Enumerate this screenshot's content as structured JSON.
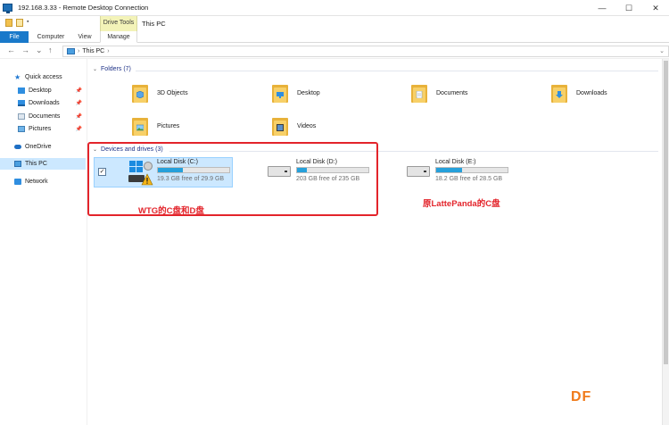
{
  "rdp": {
    "title": "192.168.3.33 - Remote Desktop Connection",
    "minimize": "—",
    "maximize": "☐",
    "close": "✕"
  },
  "explorer": {
    "title": "This PC",
    "drive_tools": "Drive Tools",
    "ribbon_tabs": [
      "File",
      "Computer",
      "View",
      "Manage"
    ]
  },
  "address": {
    "back": "←",
    "forward": "→",
    "recent": "⌄",
    "up": "↑",
    "sep": "›",
    "path": "This PC",
    "dropdown": "⌄"
  },
  "sidebar": {
    "quick_access": "Quick access",
    "items": [
      "Desktop",
      "Downloads",
      "Documents",
      "Pictures"
    ],
    "pin": "📌",
    "onedrive": "OneDrive",
    "this_pc": "This PC",
    "network": "Network"
  },
  "folders": {
    "header": "Folders (7)",
    "items": [
      "3D Objects",
      "Desktop",
      "Documents",
      "Downloads",
      "Pictures",
      "Videos"
    ]
  },
  "drives": {
    "header": "Devices and drives (3)",
    "items": [
      {
        "name": "Local Disk (C:)",
        "free": "19.3 GB free of 29.9 GB",
        "used_fraction": 0.35
      },
      {
        "name": "Local Disk (D:)",
        "free": "203 GB free of 235 GB",
        "used_fraction": 0.14
      },
      {
        "name": "Local Disk (E:)",
        "free": "18.2 GB free of 28.5 GB",
        "used_fraction": 0.36
      }
    ]
  },
  "annotations": {
    "wtg": "WTG的C盘和D盘",
    "original": "原LattePanda的C盘",
    "watermark": "DF"
  },
  "colors": {
    "accent": "#1979ca",
    "selection": "#cce8ff",
    "bar_fill": "#26a0da",
    "annotation_red": "#e3242b",
    "watermark_orange": "#f07a1a"
  }
}
